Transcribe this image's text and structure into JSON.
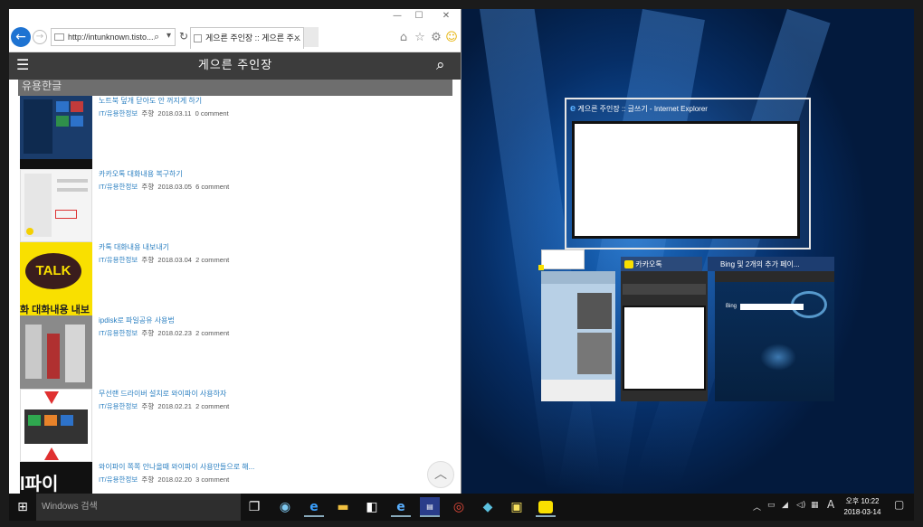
{
  "browser": {
    "address": "http://intunknown.tisto...",
    "tab_title": "게으른 주인장 :: 게으른 주...",
    "window_controls": [
      "—",
      "☐",
      "✕"
    ]
  },
  "site": {
    "title": "게으른 주인장",
    "category": "유용한글",
    "scroll_top_icon": "chevron-up-icon"
  },
  "posts": [
    {
      "title": "노트북 덮개 닫아도 안 꺼지게 하기",
      "category": "IT/유용한정보",
      "author": "주향",
      "date": "2018.03.11",
      "comments": "0 comment"
    },
    {
      "title": "카카오톡 대화내용 복구하기",
      "category": "IT/유용한정보",
      "author": "주향",
      "date": "2018.03.05",
      "comments": "6 comment"
    },
    {
      "title": "카톡 대화내용 내보내기",
      "category": "IT/유용한정보",
      "author": "주향",
      "date": "2018.03.04",
      "comments": "2 comment"
    },
    {
      "title": "ipdisk로 파일공유 사용법",
      "category": "IT/유용한정보",
      "author": "주향",
      "date": "2018.02.23",
      "comments": "2 comment"
    },
    {
      "title": "무선랜 드라이버 설치로 와이파이 사용하자",
      "category": "IT/유용한정보",
      "author": "주향",
      "date": "2018.02.21",
      "comments": "2 comment"
    },
    {
      "title": "와이파이 쪽쪽 안나올때 와이파이 사용만들으로 해...",
      "category": "IT/유용한정보",
      "author": "주향",
      "date": "2018.02.20",
      "comments": "3 comment"
    }
  ],
  "thumb_texts": {
    "talk": "TALK",
    "talk_caption": "화 대화내용 내보",
    "wifi": "l파이"
  },
  "taskview": {
    "main_title": "게으른 주인장 :: 글쓰기 - Internet Explorer",
    "items": [
      {
        "label": ""
      },
      {
        "label": "카카오톡"
      },
      {
        "label": "Bing 및 2개의 추가 페이..."
      }
    ],
    "bing_label": "Bing"
  },
  "taskbar": {
    "search_placeholder": "Windows 검색",
    "ime": "A",
    "time_period": "오후 10:22",
    "date": "2018-03-14"
  },
  "colors": {
    "ie_blue": "#1e73d2",
    "link_blue": "#2a7fc1",
    "header_gray": "#3c3c3c",
    "kakao_yellow": "#f9e000"
  }
}
